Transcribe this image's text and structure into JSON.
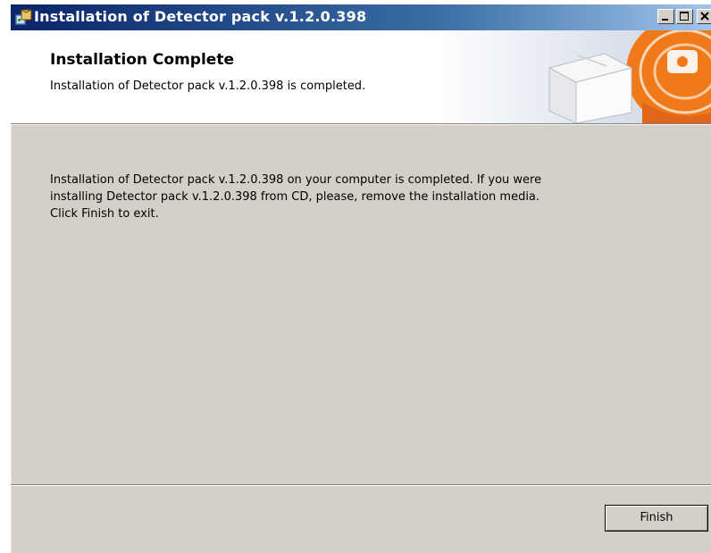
{
  "window": {
    "title": "Installation of Detector pack v.1.2.0.398",
    "controls": {
      "minimize": "minimize-icon",
      "maximize": "maximize-icon",
      "close": "close-icon"
    }
  },
  "header": {
    "title": "Installation Complete",
    "subtitle": "Installation of Detector pack v.1.2.0.398 is completed."
  },
  "body": {
    "lines": [
      "Installation of Detector pack v.1.2.0.398 on your computer is completed. If you were",
      "installing Detector pack v.1.2.0.398 from CD, please, remove the installation media.",
      "Click Finish to exit."
    ]
  },
  "footer": {
    "finish_label": "Finish"
  },
  "colors": {
    "title_bar": "#0a246a",
    "dialog_bg": "#d4d0c8",
    "header_bg": "#ffffff",
    "accent_orange": "#f07a1a"
  }
}
